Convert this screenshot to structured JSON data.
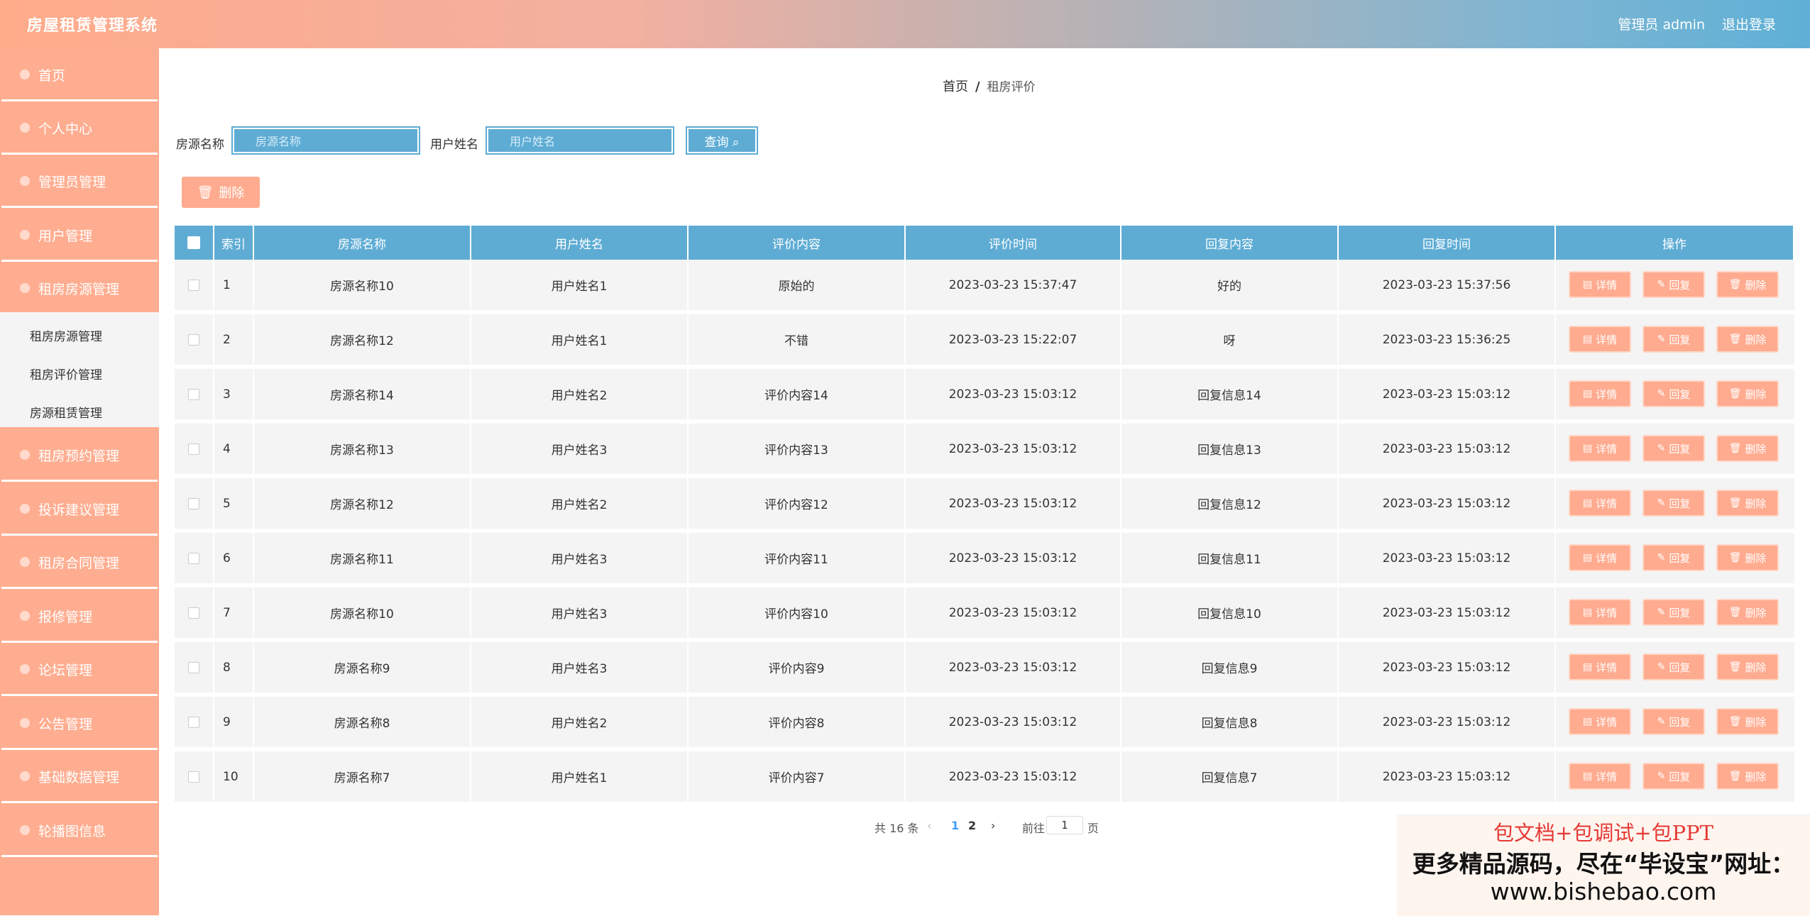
{
  "header": {
    "title": "房屋租赁管理系统",
    "user": "管理员 admin",
    "logout": "退出登录"
  },
  "sidebar": {
    "items": [
      "首页",
      "个人中心",
      "管理员管理",
      "用户管理",
      "租房房源管理",
      "租房预约管理",
      "投诉建议管理",
      "租房合同管理",
      "报修管理",
      "论坛管理",
      "公告管理",
      "基础数据管理",
      "轮播图信息"
    ],
    "submenu": [
      "租房房源管理",
      "租房评价管理",
      "房源租赁管理"
    ]
  },
  "breadcrumb": {
    "home": "首页",
    "sep": "/",
    "current": "租房评价"
  },
  "search": {
    "house_label": "房源名称",
    "house_placeholder": "房源名称",
    "user_label": "用户姓名",
    "user_placeholder": "用户姓名",
    "query_button": "查询 ⌕"
  },
  "toolbar": {
    "delete_label": "删除"
  },
  "table": {
    "headers": [
      "索引",
      "房源名称",
      "用户姓名",
      "评价内容",
      "评价时间",
      "回复内容",
      "回复时间",
      "操作"
    ],
    "rows": [
      [
        "1",
        "房源名称10",
        "用户姓名1",
        "原始的",
        "2023-03-23 15:37:47",
        "好的",
        "2023-03-23 15:37:56"
      ],
      [
        "2",
        "房源名称12",
        "用户姓名1",
        "不错",
        "2023-03-23 15:22:07",
        "呀",
        "2023-03-23 15:36:25"
      ],
      [
        "3",
        "房源名称14",
        "用户姓名2",
        "评价内容14",
        "2023-03-23 15:03:12",
        "回复信息14",
        "2023-03-23 15:03:12"
      ],
      [
        "4",
        "房源名称13",
        "用户姓名3",
        "评价内容13",
        "2023-03-23 15:03:12",
        "回复信息13",
        "2023-03-23 15:03:12"
      ],
      [
        "5",
        "房源名称12",
        "用户姓名2",
        "评价内容12",
        "2023-03-23 15:03:12",
        "回复信息12",
        "2023-03-23 15:03:12"
      ],
      [
        "6",
        "房源名称11",
        "用户姓名3",
        "评价内容11",
        "2023-03-23 15:03:12",
        "回复信息11",
        "2023-03-23 15:03:12"
      ],
      [
        "7",
        "房源名称10",
        "用户姓名3",
        "评价内容10",
        "2023-03-23 15:03:12",
        "回复信息10",
        "2023-03-23 15:03:12"
      ],
      [
        "8",
        "房源名称9",
        "用户姓名3",
        "评价内容9",
        "2023-03-23 15:03:12",
        "回复信息9",
        "2023-03-23 15:03:12"
      ],
      [
        "9",
        "房源名称8",
        "用户姓名2",
        "评价内容8",
        "2023-03-23 15:03:12",
        "回复信息8",
        "2023-03-23 15:03:12"
      ],
      [
        "10",
        "房源名称7",
        "用户姓名1",
        "评价内容7",
        "2023-03-23 15:03:12",
        "回复信息7",
        "2023-03-23 15:03:12"
      ]
    ],
    "actions": [
      "详情",
      "回复",
      "删除"
    ]
  },
  "pagination": {
    "total": "共 16 条",
    "prev": "‹",
    "pages": [
      "1",
      "2"
    ],
    "next": "›",
    "goto": "前往",
    "page_value": "1",
    "page_suffix": "页"
  },
  "promo": {
    "line1": "包文档+包调试+包PPT",
    "line2": "更多精品源码，尽在“毕设宝”网址：",
    "line3": "www.bishebao.com"
  },
  "colors": {
    "accent_blue": "#5eacd4",
    "accent_orange": "#ffab8f",
    "promo_red": "#e53935"
  }
}
